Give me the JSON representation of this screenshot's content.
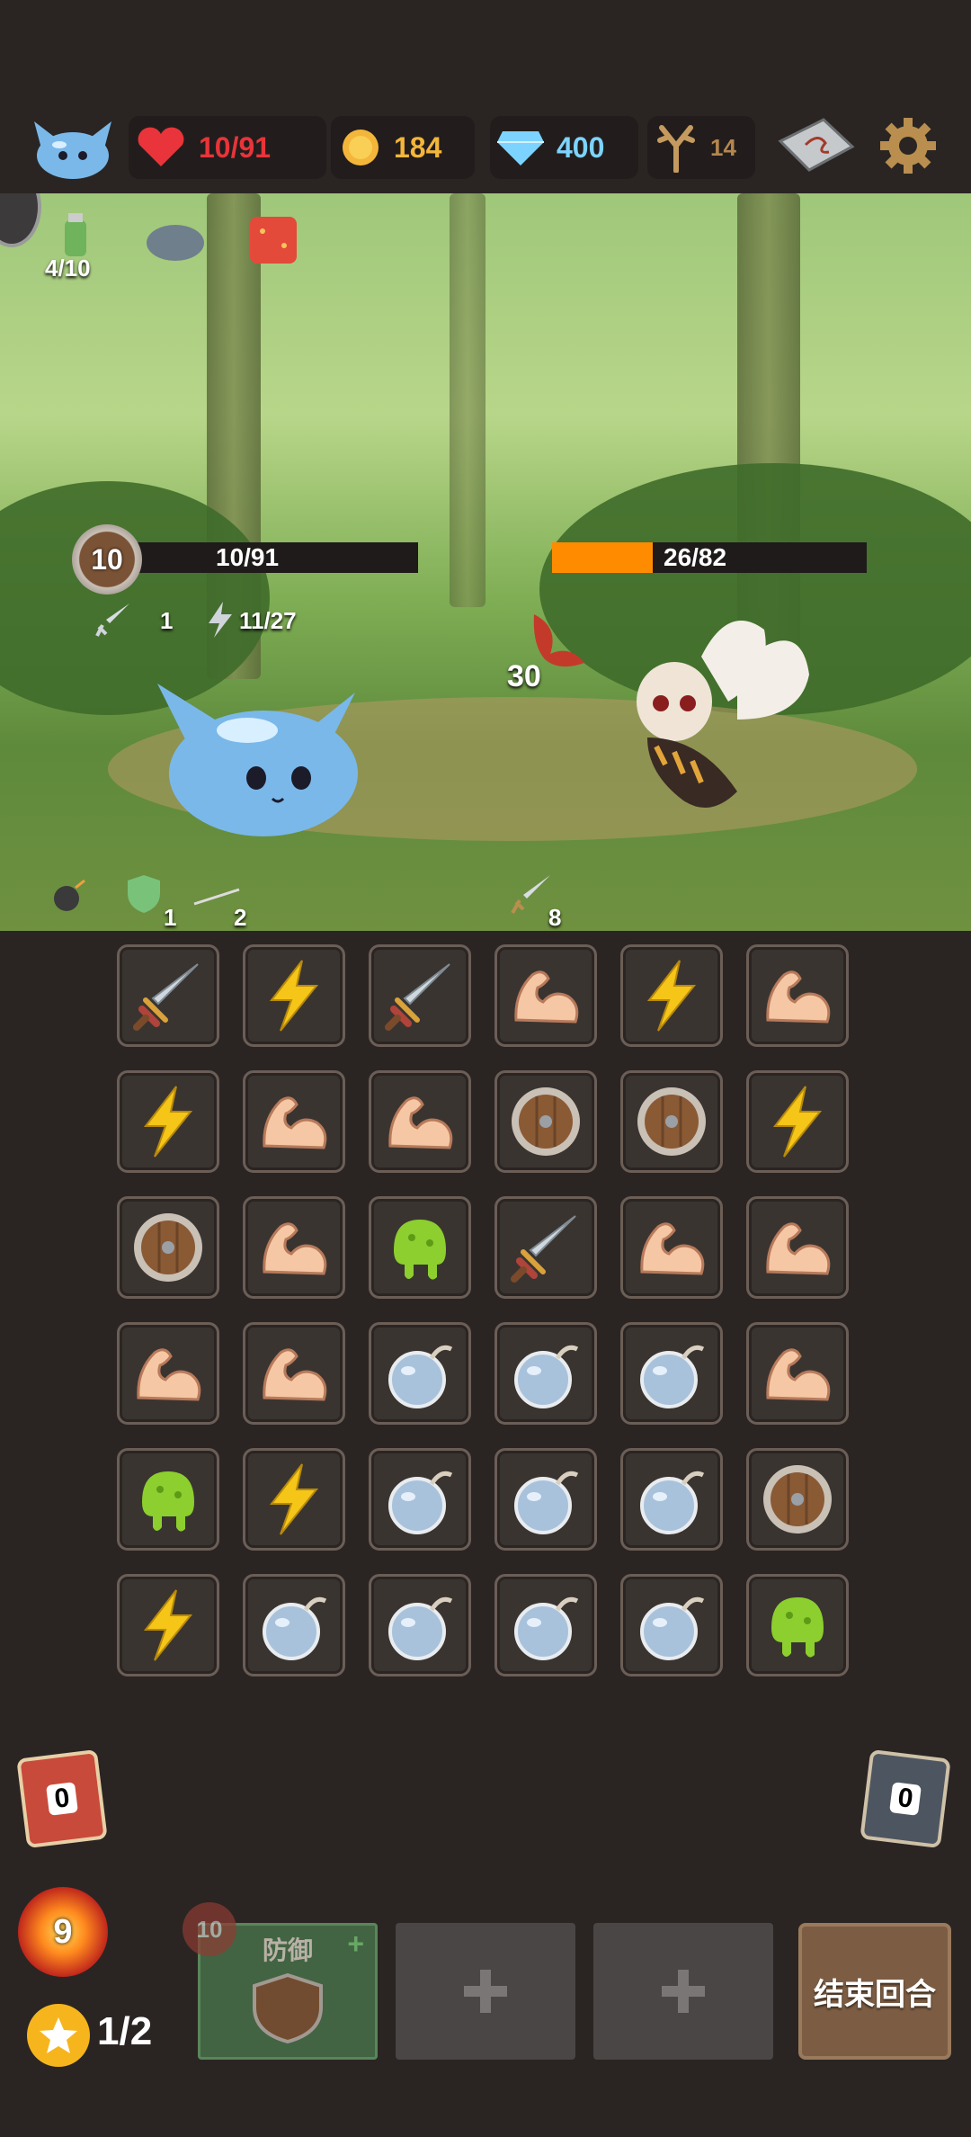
{
  "top_bar": {
    "hp": "10/91",
    "gold": "184",
    "gems": "400",
    "antlers": "14"
  },
  "scene": {
    "potion_count": "4/10",
    "player": {
      "shield": "10",
      "hp_text": "10/91",
      "attack": "1",
      "energy": "11/27",
      "status_shield": "1",
      "status_arrow": "2"
    },
    "enemy": {
      "hp_text": "26/82",
      "hp_fraction": 0.32,
      "intent_damage": "30",
      "attack_status": "8"
    }
  },
  "grid": {
    "rows": [
      [
        "sword",
        "lightning",
        "sword",
        "muscle",
        "lightning",
        "muscle"
      ],
      [
        "lightning",
        "muscle",
        "muscle",
        "shield",
        "shield",
        "lightning"
      ],
      [
        "shield",
        "muscle",
        "slime",
        "sword",
        "muscle",
        "muscle"
      ],
      [
        "muscle",
        "muscle",
        "bomb",
        "bomb",
        "bomb",
        "muscle"
      ],
      [
        "slime",
        "lightning",
        "bomb",
        "bomb",
        "bomb",
        "shield"
      ],
      [
        "lightning",
        "bomb",
        "bomb",
        "bomb",
        "bomb",
        "slime"
      ]
    ]
  },
  "bottom": {
    "draw_pile": "0",
    "discard_pile": "0",
    "energy_orb": "9",
    "stars": "1/2",
    "skill_slot": {
      "label": "防御",
      "cost": "10"
    },
    "end_turn": "结束回合"
  },
  "colors": {
    "hp_red": "#e8343a",
    "gold": "#f4b63a",
    "gem": "#7dd3ff",
    "antler": "#b4874f",
    "enemy_hp": "#ff8c00"
  }
}
